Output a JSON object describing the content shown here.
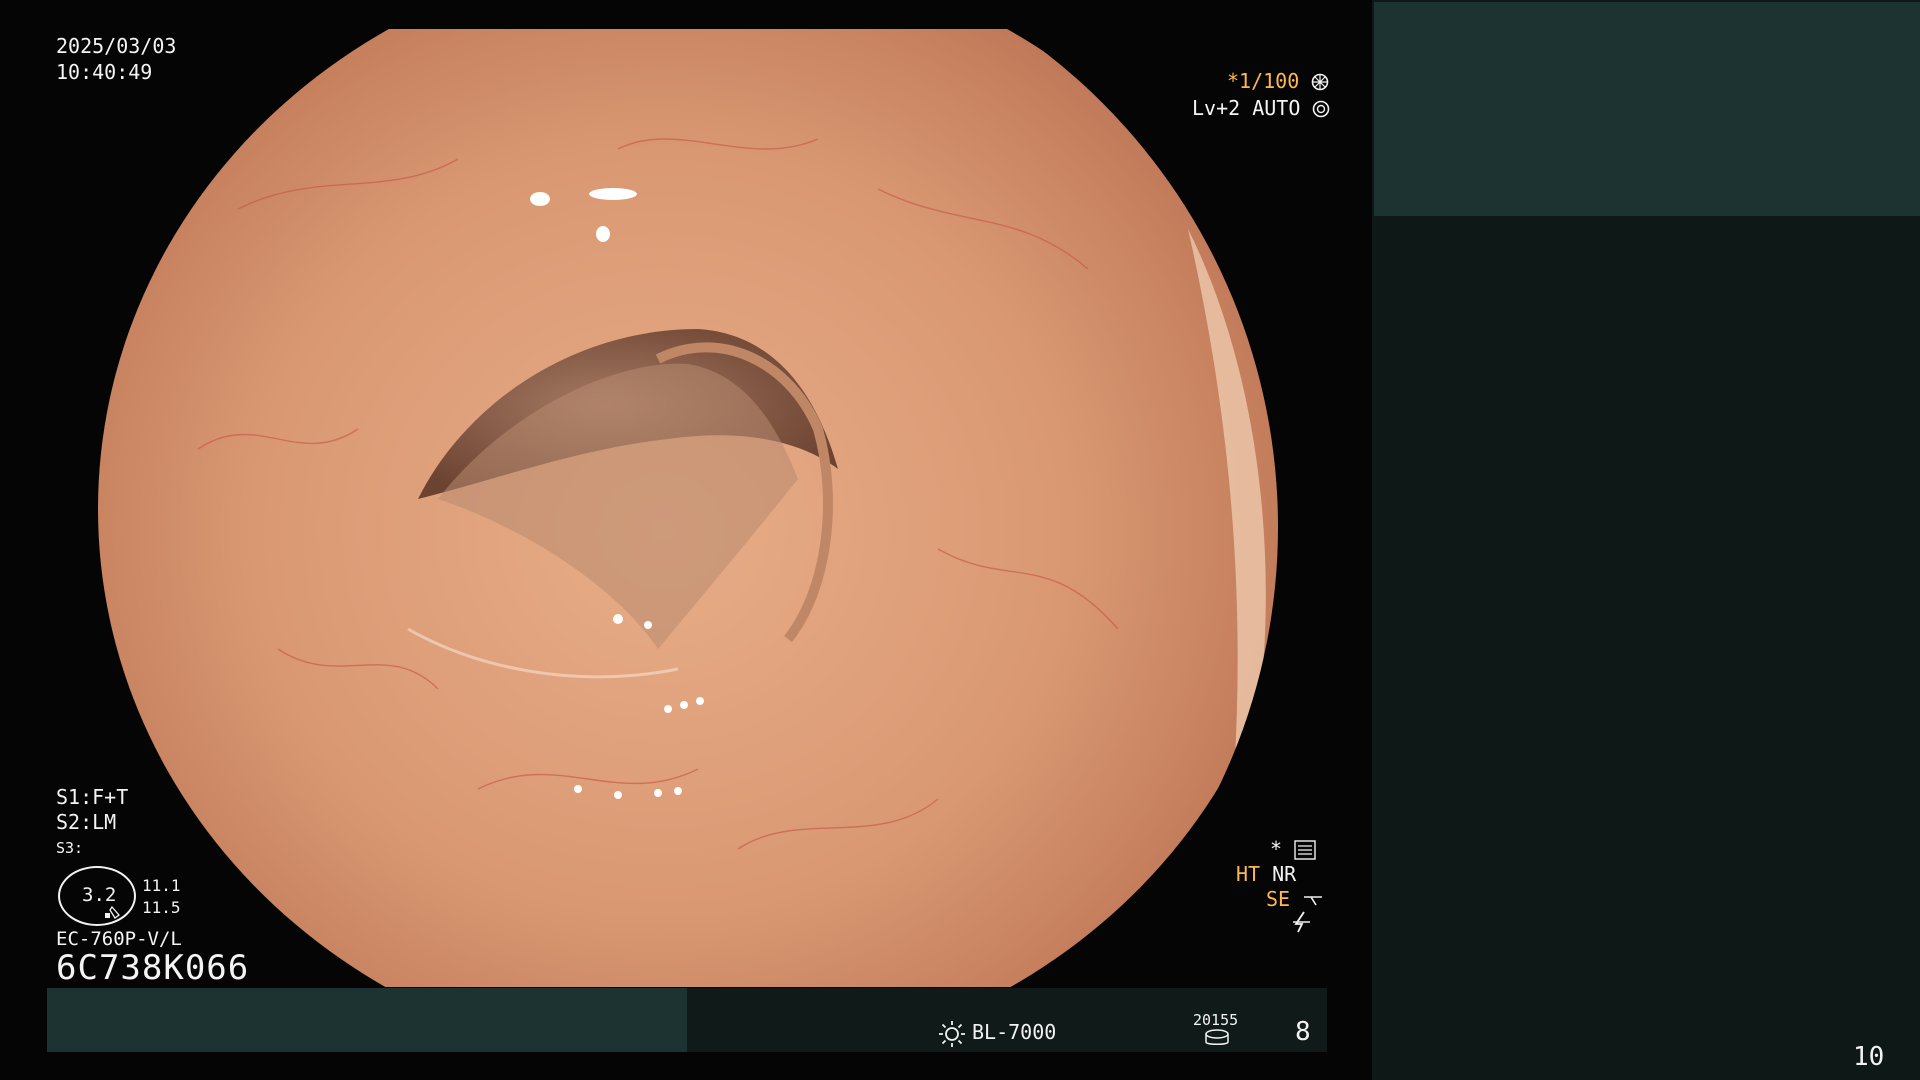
{
  "osd": {
    "date": "2025/03/03",
    "time": "10:40:49",
    "shutter": "*1/100",
    "level": "Lv+2 AUTO",
    "s1": "S1:F+T",
    "s2": "S2:LM",
    "s3": "S3:",
    "zoom": "3.2",
    "sub_value_1": "11.1",
    "sub_value_2": "11.5",
    "scope_model": "EC-760P-V/L",
    "scope_serial": "6C738K066",
    "star": "*",
    "ht": "HT",
    "nr": "NR",
    "se": "SE"
  },
  "status_bar": {
    "light_source": "BL-7000",
    "counter": "20155",
    "page": "8"
  },
  "right_panel": {
    "number": "10"
  },
  "colors": {
    "amber_text": "#ffb84d",
    "teal_panel": "#1c3331",
    "dark_panel": "#0e1816"
  },
  "icons": [
    "shutter-wheel-icon",
    "auto-iris-icon",
    "settings-panel-icon",
    "enhance-curve-icon",
    "bolt-icon",
    "sun-icon",
    "disk-icon",
    "scope-tip-icon"
  ]
}
